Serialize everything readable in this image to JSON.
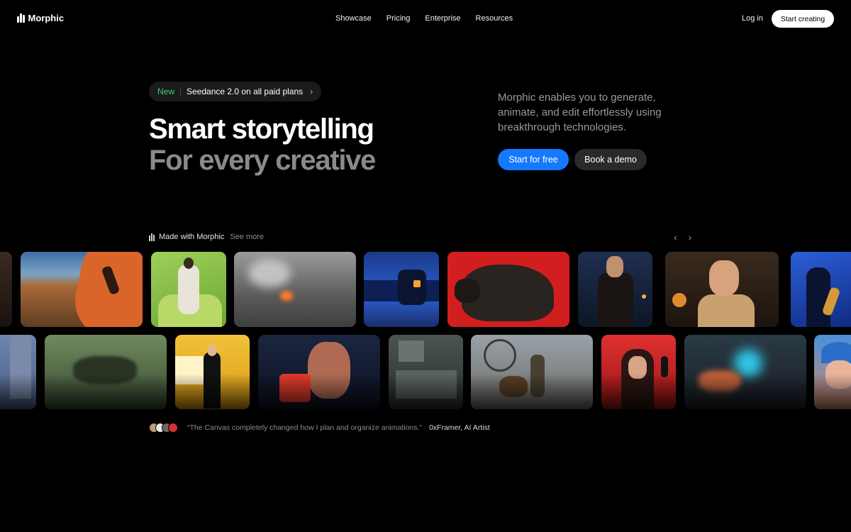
{
  "nav": {
    "brand": "Morphic",
    "links": [
      "Showcase",
      "Pricing",
      "Enterprise",
      "Resources"
    ],
    "login": "Log in",
    "cta": "Start creating"
  },
  "hero": {
    "badge_new": "New",
    "badge_text": "Seedance 2.0 on all paid plans",
    "title_line1": "Smart storytelling",
    "title_line2": "For every creative",
    "description": "Morphic enables you to generate, animate, and edit effortlessly using breakthrough technologies.",
    "primary_cta": "Start for free",
    "secondary_cta": "Book a demo"
  },
  "gallery": {
    "label": "Made with Morphic",
    "see_more": "See more"
  },
  "testimonial": {
    "quote": "“The Canvas completely changed how I plan and organize animations.”",
    "author": "0xFramer, AI Artist"
  },
  "colors": {
    "accent": "#1479ff",
    "badge_new": "#3fd36c",
    "background": "#000000"
  }
}
